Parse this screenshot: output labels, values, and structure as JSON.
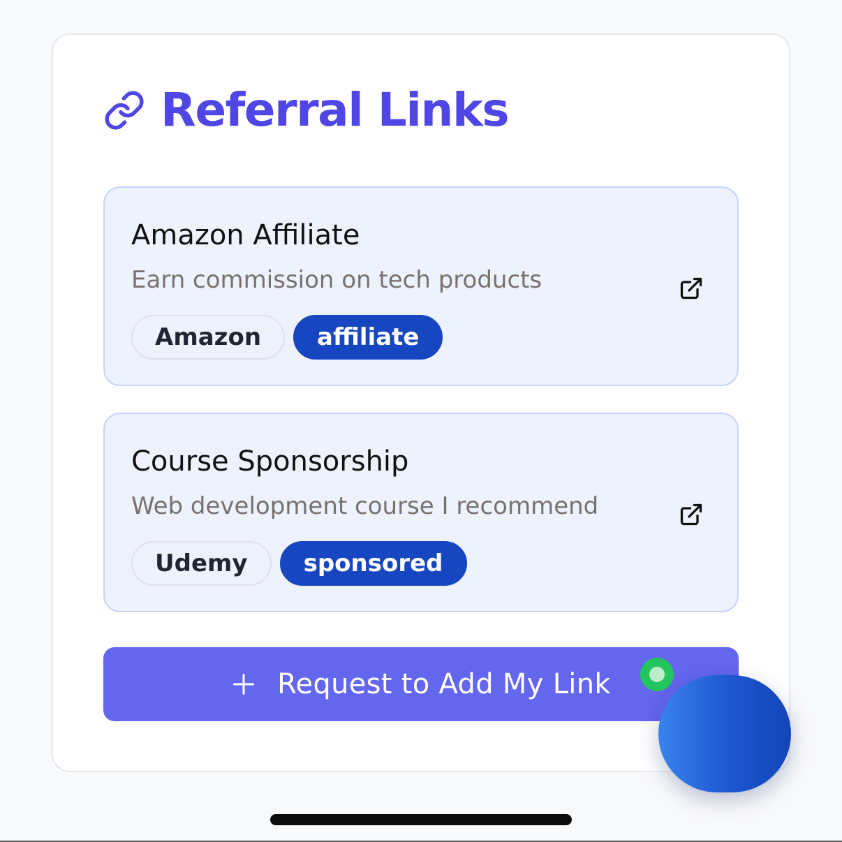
{
  "header": {
    "title": "Referral Links",
    "icon": "link-icon",
    "accent_color": "#4f46e5"
  },
  "links": [
    {
      "title": "Amazon Affiliate",
      "description": "Earn commission on tech products",
      "tags": [
        {
          "label": "Amazon",
          "style": "outline"
        },
        {
          "label": "affiliate",
          "style": "filled"
        }
      ],
      "action_icon": "external-link-icon"
    },
    {
      "title": "Course Sponsorship",
      "description": "Web development course I recommend",
      "tags": [
        {
          "label": "Udemy",
          "style": "outline"
        },
        {
          "label": "sponsored",
          "style": "filled"
        }
      ],
      "action_icon": "external-link-icon"
    }
  ],
  "request_button": {
    "label": "Request to Add My Link",
    "icon": "plus-icon",
    "color": "#6466ee"
  },
  "colors": {
    "card_bg": "#eef2fd",
    "card_border": "#c8d3fb",
    "tag_filled": "#1747c0",
    "status_online": "#22c55e"
  }
}
